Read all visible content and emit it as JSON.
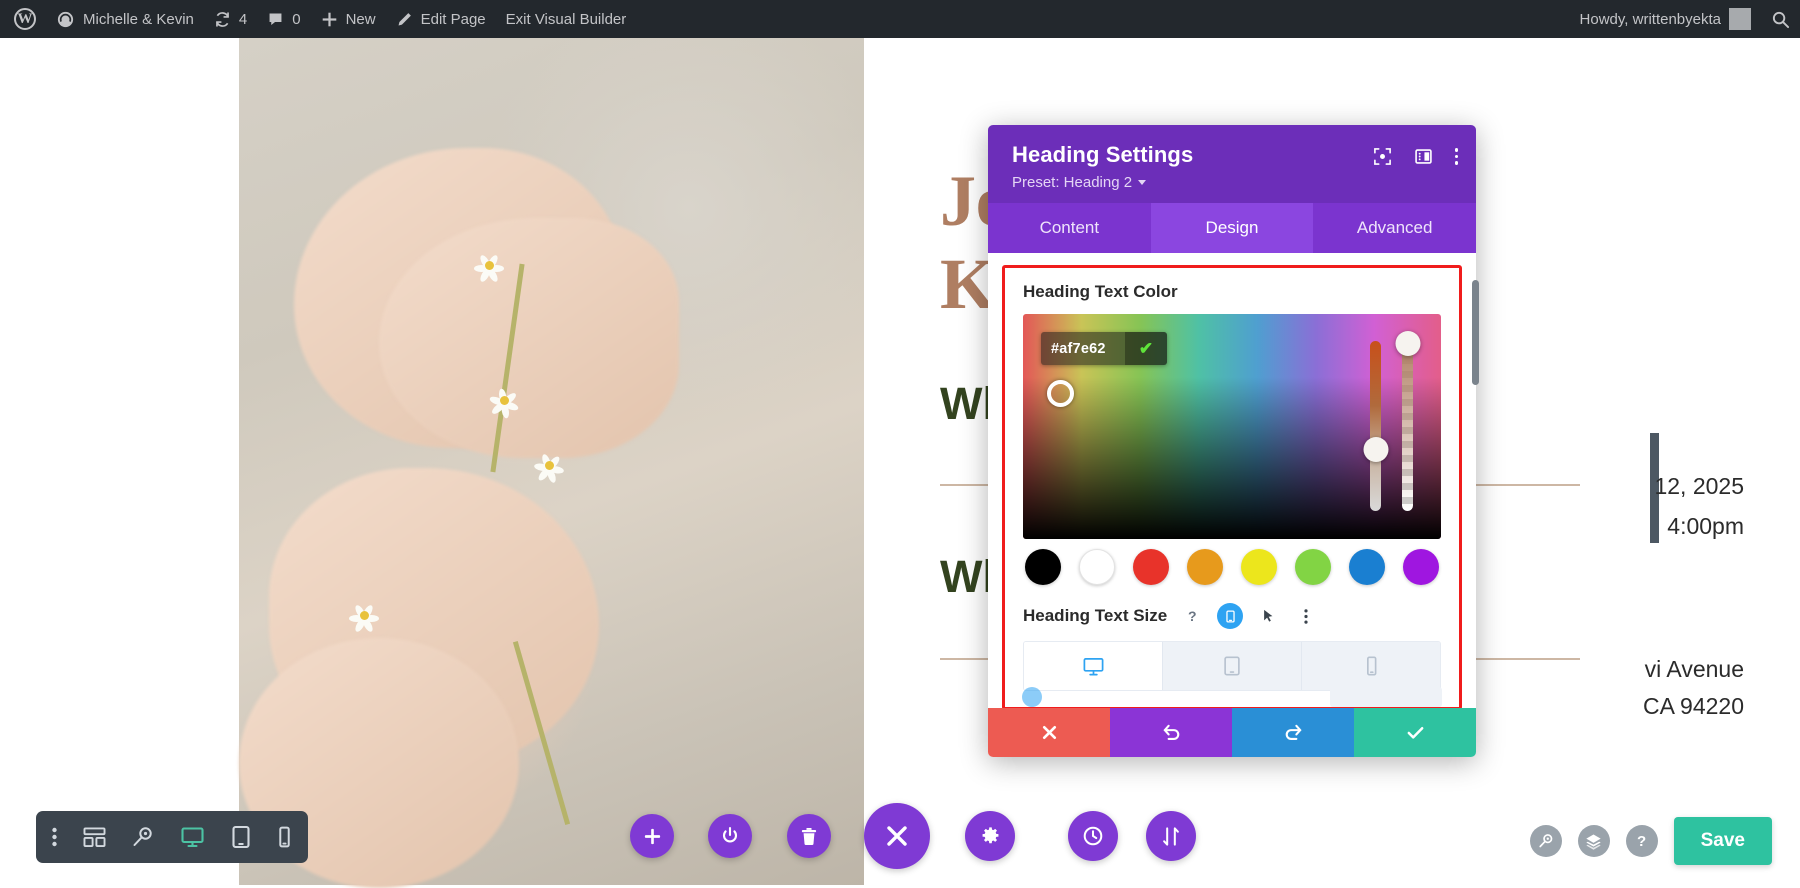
{
  "admin_bar": {
    "logo_icon": "wordpress-logo-icon",
    "site_name": "Michelle & Kevin",
    "site_icon": "dashboard-speedometer-icon",
    "updates_icon": "updates-refresh-icon",
    "updates_count": "4",
    "comments_icon": "comment-bubble-icon",
    "comments_count": "0",
    "new_icon": "plus-icon",
    "new_label": "New",
    "edit_icon": "pencil-edit-icon",
    "edit_label": "Edit Page",
    "exit_label": "Exit Visual Builder",
    "howdy": "Howdy, writtenbyekta",
    "avatar_icon": "user-avatar-icon",
    "search_icon": "search-icon"
  },
  "page": {
    "heading_1_line_1": "Jo                e",
    "heading_1_line_2": "Kn",
    "subheading_1": "Wh",
    "subheading_2": "Wh",
    "date_text": "12, 2025",
    "time_text": "4:00pm",
    "address_line_1": "vi Avenue",
    "address_line_2": "CA 94220",
    "heading_color": "#af7e62",
    "subheading_color": "#33431f"
  },
  "modal": {
    "title": "Heading Settings",
    "preset_label": "Preset: Heading 2",
    "header_icons": [
      {
        "name": "focus-target-icon"
      },
      {
        "name": "layout-panel-icon"
      },
      {
        "name": "more-vertical-icon"
      }
    ],
    "tabs": [
      {
        "label": "Content",
        "active": false
      },
      {
        "label": "Design",
        "active": true
      },
      {
        "label": "Advanced",
        "active": false
      }
    ],
    "color_field": {
      "label": "Heading Text Color",
      "hex_value": "#af7e62",
      "confirm_icon": "checkmark-icon",
      "sat_handle_icon": "color-picker-handle-icon",
      "hue_slider_name": "hue-slider",
      "alpha_slider_name": "alpha-slider",
      "swatches": [
        {
          "name": "black",
          "hex": "#000000"
        },
        {
          "name": "white",
          "hex": "#ffffff"
        },
        {
          "name": "red",
          "hex": "#e8332a"
        },
        {
          "name": "orange",
          "hex": "#e79a1c"
        },
        {
          "name": "yellow",
          "hex": "#ece61c"
        },
        {
          "name": "green",
          "hex": "#82d444"
        },
        {
          "name": "blue",
          "hex": "#1a7fd1"
        },
        {
          "name": "purple",
          "hex": "#9f16e0"
        }
      ]
    },
    "size_field": {
      "label": "Heading Text Size",
      "help_icon": "question-help-icon",
      "responsive_icon": "responsive-mobile-icon",
      "hover_icon": "cursor-pointer-icon",
      "more_icon": "more-vertical-icon",
      "devices": [
        {
          "name": "desktop",
          "icon": "desktop-monitor-icon",
          "active": true
        },
        {
          "name": "tablet",
          "icon": "tablet-icon",
          "active": false
        },
        {
          "name": "phone",
          "icon": "mobile-phone-icon",
          "active": false
        }
      ]
    },
    "footer_buttons": [
      {
        "name": "cancel-button",
        "icon": "close-x-icon",
        "color": "#ed5b52"
      },
      {
        "name": "undo-button",
        "icon": "undo-icon",
        "color": "#8b34d6"
      },
      {
        "name": "redo-button",
        "icon": "redo-icon",
        "color": "#2a8fd6"
      },
      {
        "name": "save-button",
        "icon": "checkmark-icon",
        "color": "#2ec2a0"
      }
    ],
    "highlight_color": "#f01c1c",
    "header_color": "#6c2eb9"
  },
  "bottom_toolbar": {
    "items": [
      {
        "name": "more-options",
        "icon": "more-vertical-icon",
        "active": false
      },
      {
        "name": "wireframe-view",
        "icon": "wireframe-grid-icon",
        "active": false
      },
      {
        "name": "zoom-view",
        "icon": "magnifier-zoom-icon",
        "active": false
      },
      {
        "name": "desktop-view",
        "icon": "desktop-monitor-icon",
        "active": true
      },
      {
        "name": "tablet-view",
        "icon": "tablet-icon",
        "active": false
      },
      {
        "name": "phone-view",
        "icon": "mobile-phone-icon",
        "active": false
      }
    ]
  },
  "float_buttons": [
    {
      "name": "add-module-button",
      "icon": "plus-icon",
      "size": "sm"
    },
    {
      "name": "toggle-module-button",
      "icon": "power-toggle-icon",
      "size": "sm"
    },
    {
      "name": "delete-module-button",
      "icon": "trash-delete-icon",
      "size": "sm"
    },
    {
      "name": "close-builder-button",
      "icon": "close-x-icon",
      "size": "lg"
    },
    {
      "name": "settings-button",
      "icon": "gear-settings-icon",
      "size": "md"
    },
    {
      "name": "history-button",
      "icon": "clock-history-icon",
      "size": "md"
    },
    {
      "name": "portability-button",
      "icon": "sort-updown-arrows-icon",
      "size": "md"
    }
  ],
  "bottom_right": {
    "icons": [
      {
        "name": "search-icon"
      },
      {
        "name": "layers-icon"
      },
      {
        "name": "help-question-icon"
      }
    ],
    "save_label": "Save"
  }
}
